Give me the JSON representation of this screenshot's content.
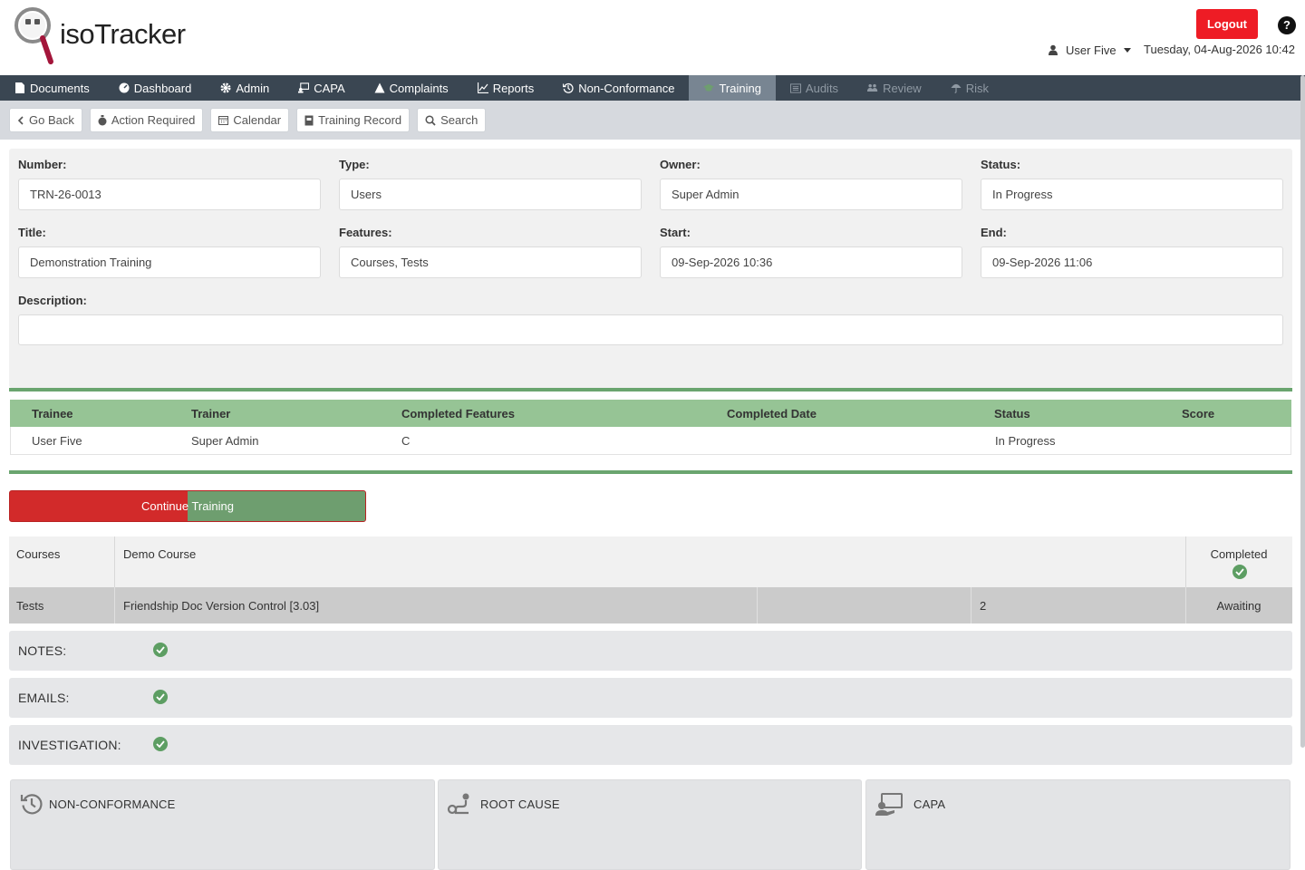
{
  "header": {
    "logo_text": "isoTracker",
    "logout_label": "Logout",
    "help_label": "?",
    "user_name": "User Five",
    "datetime": "Tuesday, 04-Aug-2026 10:42"
  },
  "nav": {
    "items": [
      {
        "label": "Documents",
        "icon": "document-icon",
        "state": "normal"
      },
      {
        "label": "Dashboard",
        "icon": "dashboard-icon",
        "state": "normal"
      },
      {
        "label": "Admin",
        "icon": "gear-icon",
        "state": "normal"
      },
      {
        "label": "CAPA",
        "icon": "capa-icon",
        "state": "normal"
      },
      {
        "label": "Complaints",
        "icon": "warning-icon",
        "state": "normal"
      },
      {
        "label": "Reports",
        "icon": "chart-icon",
        "state": "normal"
      },
      {
        "label": "Non-Conformance",
        "icon": "history-icon",
        "state": "normal"
      },
      {
        "label": "Training",
        "icon": "graduation-icon",
        "state": "active"
      },
      {
        "label": "Audits",
        "icon": "list-icon",
        "state": "disabled"
      },
      {
        "label": "Review",
        "icon": "users-icon",
        "state": "disabled"
      },
      {
        "label": "Risk",
        "icon": "umbrella-icon",
        "state": "disabled"
      }
    ]
  },
  "toolbar": {
    "go_back": "Go Back",
    "action_required": "Action Required",
    "calendar": "Calendar",
    "training_record": "Training Record",
    "search": "Search"
  },
  "form": {
    "number_label": "Number:",
    "number_value": "TRN-26-0013",
    "type_label": "Type:",
    "type_value": "Users",
    "owner_label": "Owner:",
    "owner_value": "Super Admin",
    "status_label": "Status:",
    "status_value": "In Progress",
    "title_label": "Title:",
    "title_value": "Demonstration Training",
    "features_label": "Features:",
    "features_value": "Courses, Tests",
    "start_label": "Start:",
    "start_value": "09-Sep-2026 10:36",
    "end_label": "End:",
    "end_value": "09-Sep-2026 11:06",
    "description_label": "Description:",
    "description_value": ""
  },
  "trainees": {
    "columns": [
      "Trainee",
      "Trainer",
      "Completed Features",
      "Completed Date",
      "Status",
      "Score"
    ],
    "rows": [
      [
        "User Five",
        "Super Admin",
        "C",
        "",
        "In Progress",
        ""
      ]
    ]
  },
  "progress": {
    "label": "Continue Training",
    "completed_fraction": 0.5
  },
  "features": {
    "courses": {
      "label": "Courses",
      "name": "Demo Course",
      "status": "Completed"
    },
    "tests": {
      "label": "Tests",
      "name": "Friendship Doc Version Control [3.03]",
      "col3": "",
      "count": "2",
      "status": "Awaiting"
    }
  },
  "sections": [
    {
      "label": "NOTES:",
      "done": true
    },
    {
      "label": "EMAILS:",
      "done": true
    },
    {
      "label": "INVESTIGATION:",
      "done": true
    }
  ],
  "cards": [
    {
      "label": "NON-CONFORMANCE",
      "icon": "history-icon"
    },
    {
      "label": "ROOT CAUSE",
      "icon": "root-cause-icon"
    },
    {
      "label": "CAPA",
      "icon": "capa-icon"
    }
  ],
  "colors": {
    "logout": "#ee1c25",
    "nav_bg": "#3a4652",
    "nav_active": "#788592",
    "table_header": "#96c495",
    "progress_remaining": "#d22a2a",
    "progress_done": "#6e9e6f",
    "check": "#5d9e63"
  }
}
